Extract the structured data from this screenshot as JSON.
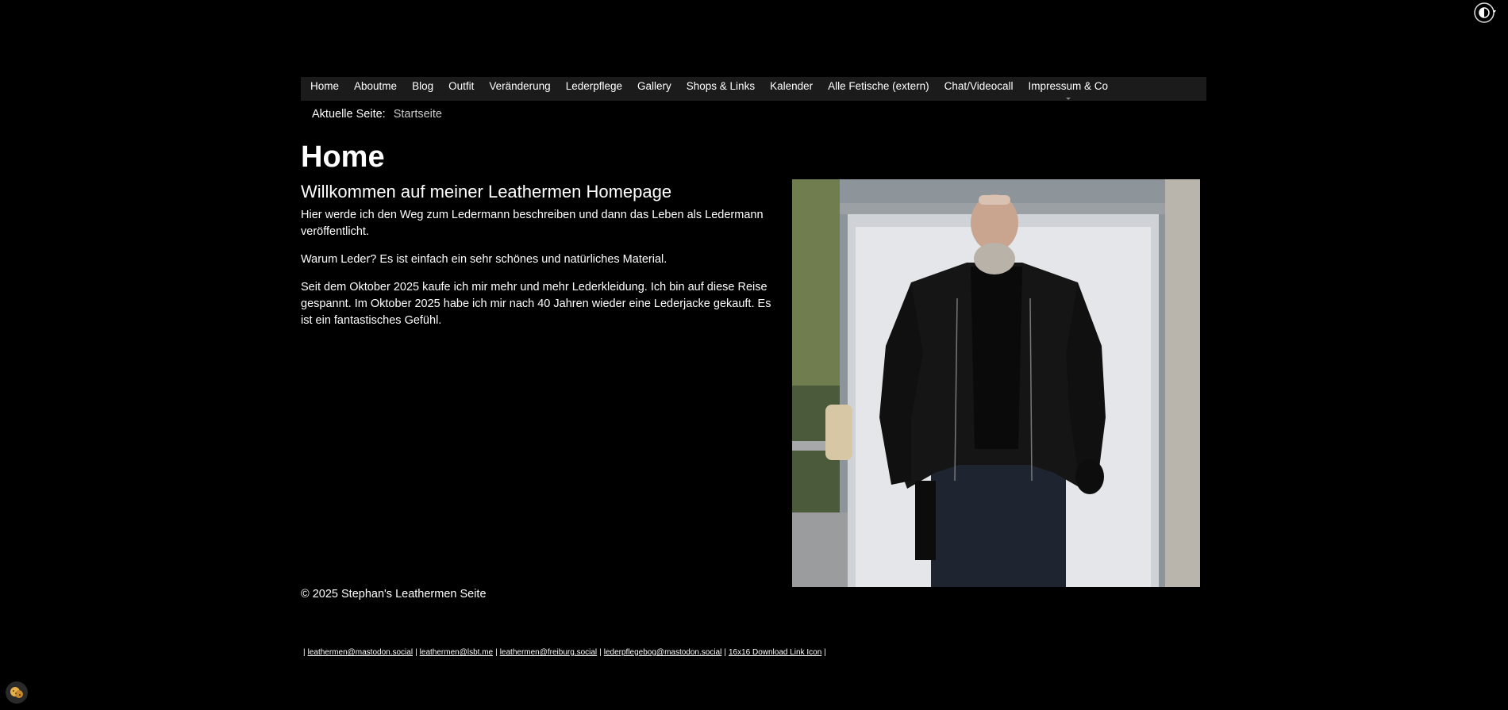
{
  "nav": {
    "items": [
      {
        "label": "Home"
      },
      {
        "label": "Aboutme"
      },
      {
        "label": "Blog"
      },
      {
        "label": "Outfit"
      },
      {
        "label": "Veränderung"
      },
      {
        "label": "Lederpflege"
      },
      {
        "label": "Gallery"
      },
      {
        "label": "Shops & Links"
      },
      {
        "label": "Kalender"
      },
      {
        "label": "Alle Fetische (extern)"
      },
      {
        "label": "Chat/Videocall"
      },
      {
        "label": "Impressum & Co"
      }
    ]
  },
  "breadcrumb": {
    "label": "Aktuelle Seite:",
    "current": "Startseite"
  },
  "page": {
    "title": "Home",
    "heading": "Willkommen auf meiner Leathermen Homepage",
    "paragraphs": [
      "Hier werde ich den Weg zum Ledermann beschreiben und dann das Leben als Ledermann veröffentlicht.",
      "Warum Leder? Es ist einfach ein sehr schönes und natürliches Material.",
      "Seit dem Oktober 2025 kaufe ich mir mehr und mehr Lederkleidung. Ich bin auf diese Reise gespannt. Im Oktober 2025 habe ich mir nach 40 Jahren wieder eine Lederjacke gekauft. Es ist ein fantastisches Gefühl."
    ]
  },
  "footer": {
    "copyright": "© 2025 Stephan's Leathermen Seite",
    "links": [
      "leathermen@mastodon.social",
      "leathermen@lsbt.me",
      "leathermen@freiburg.social",
      "lederpflegebog@mastodon.social",
      "16x16 Download Link Icon"
    ]
  },
  "icons": {
    "contrast": "contrast-toggle-icon",
    "cookie": "cookie-icon"
  },
  "colors": {
    "background": "#000000",
    "nav_background": "#1b1b1b",
    "text": "#ffffff"
  }
}
